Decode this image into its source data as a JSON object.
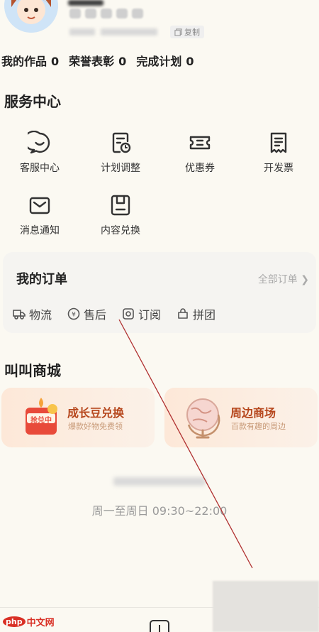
{
  "profile": {
    "copy_label": "复制"
  },
  "stats": [
    {
      "label": "我的作品",
      "value": "0"
    },
    {
      "label": "荣誉表彰",
      "value": "0"
    },
    {
      "label": "完成计划",
      "value": "0"
    }
  ],
  "service_center": {
    "title": "服务中心",
    "items": [
      {
        "label": "客服中心",
        "icon": "chat-bubble-icon"
      },
      {
        "label": "计划调整",
        "icon": "plan-edit-icon"
      },
      {
        "label": "优惠券",
        "icon": "coupon-icon"
      },
      {
        "label": "开发票",
        "icon": "invoice-icon"
      },
      {
        "label": "消息通知",
        "icon": "envelope-icon"
      },
      {
        "label": "内容兑换",
        "icon": "redeem-icon"
      }
    ]
  },
  "orders": {
    "title": "我的订单",
    "all_label": "全部订单",
    "tabs": [
      {
        "label": "物流",
        "icon": "truck-icon"
      },
      {
        "label": "售后",
        "icon": "aftersale-icon"
      },
      {
        "label": "订阅",
        "icon": "subscribe-icon"
      },
      {
        "label": "拼团",
        "icon": "group-buy-icon"
      }
    ]
  },
  "mall": {
    "title": "叫叫商城",
    "cards": [
      {
        "title": "成长豆兑换",
        "subtitle": "爆款好物免费领",
        "badge": "抢兑中"
      },
      {
        "title": "周边商场",
        "subtitle": "百款有趣的周边"
      }
    ]
  },
  "footer": {
    "service_hours": "周一至周日 09:30~22:00"
  },
  "watermark": {
    "php": "php",
    "site": "中文网"
  },
  "colors": {
    "background": "#fbf9f2",
    "accent": "#b6461c",
    "card": "#f5f4f1"
  }
}
